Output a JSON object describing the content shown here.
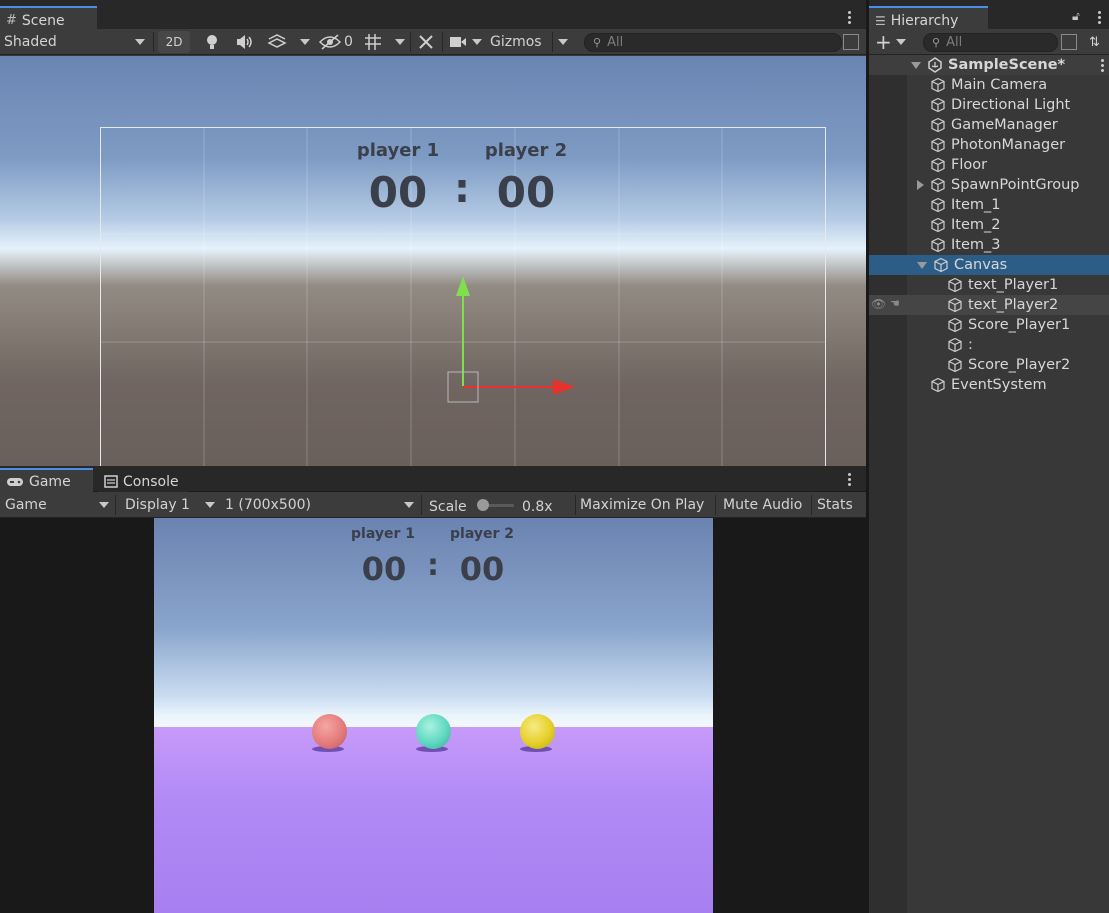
{
  "scene": {
    "tab_label": "Scene",
    "toolbar": {
      "shading_mode": "Shaded",
      "btn_2d": "2D",
      "hidden_count": "0",
      "gizmos": "Gizmos",
      "search_placeholder": "All"
    },
    "ui_text": {
      "player1": "player 1",
      "player2": "player 2",
      "score1": "00",
      "colon": ":",
      "score2": "00"
    }
  },
  "game": {
    "tabs": [
      {
        "label": "Game"
      },
      {
        "label": "Console"
      }
    ],
    "toolbar": {
      "mode": "Game",
      "display": "Display 1",
      "resolution": "1 (700x500)",
      "scale_label": "Scale",
      "scale_value": "0.8x",
      "maximize": "Maximize On Play",
      "mute": "Mute Audio",
      "stats": "Stats"
    },
    "ui_text": {
      "player1": "player 1",
      "player2": "player 2",
      "score1": "00",
      "colon": ":",
      "score2": "00"
    },
    "spheres": [
      {
        "color": "#e57b7b"
      },
      {
        "color": "#5fd8bf"
      },
      {
        "color": "#e5d02a"
      }
    ],
    "floor_color": "#b98cf5"
  },
  "hierarchy": {
    "tab_label": "Hierarchy",
    "add_label": "+",
    "search_placeholder": "All",
    "scene_name": "SampleScene*",
    "items": [
      {
        "label": "Main Camera"
      },
      {
        "label": "Directional Light"
      },
      {
        "label": "GameManager"
      },
      {
        "label": "PhotonManager"
      },
      {
        "label": "Floor"
      },
      {
        "label": "SpawnPointGroup"
      },
      {
        "label": "Item_1"
      },
      {
        "label": "Item_2"
      },
      {
        "label": "Item_3"
      },
      {
        "label": "Canvas"
      },
      {
        "label": "text_Player1"
      },
      {
        "label": "text_Player2"
      },
      {
        "label": "Score_Player1"
      },
      {
        "label": ":"
      },
      {
        "label": "Score_Player2"
      },
      {
        "label": "EventSystem"
      }
    ]
  },
  "colors": {
    "selection": "#2c5d87",
    "accent_tab": "#4b8ee8",
    "panel_bg": "#383838"
  }
}
